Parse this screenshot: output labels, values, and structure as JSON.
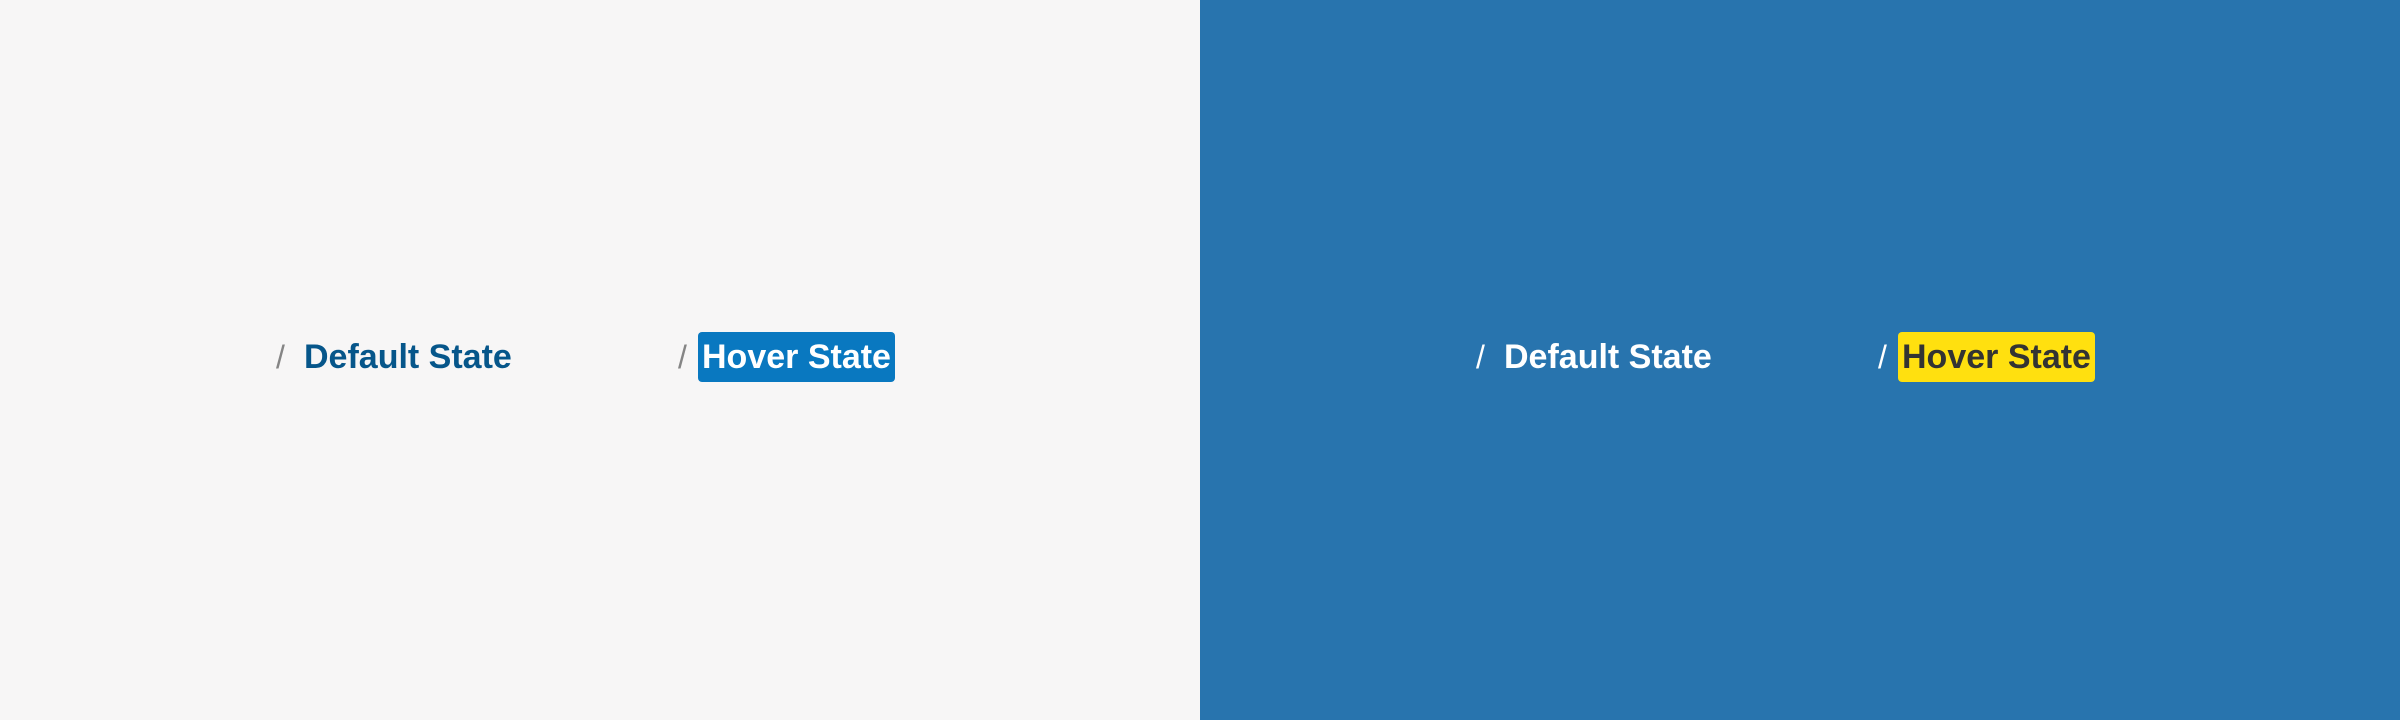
{
  "colors": {
    "light_background": "#f7f6f6",
    "dark_background": "#2874ae",
    "light_separator": "#858585",
    "light_default_text": "#06568a",
    "light_hover_bg": "#0978c0",
    "light_hover_text": "#ffffff",
    "dark_separator": "#ffffff",
    "dark_default_text": "#ffffff",
    "dark_hover_bg": "#ffe00f",
    "dark_hover_text": "#333333"
  },
  "light_panel": {
    "default_crumb": {
      "separator": "/",
      "label": "Default State"
    },
    "hover_crumb": {
      "separator": "/",
      "label": "Hover State"
    }
  },
  "dark_panel": {
    "default_crumb": {
      "separator": "/",
      "label": "Default State"
    },
    "hover_crumb": {
      "separator": "/",
      "label": "Hover State"
    }
  }
}
